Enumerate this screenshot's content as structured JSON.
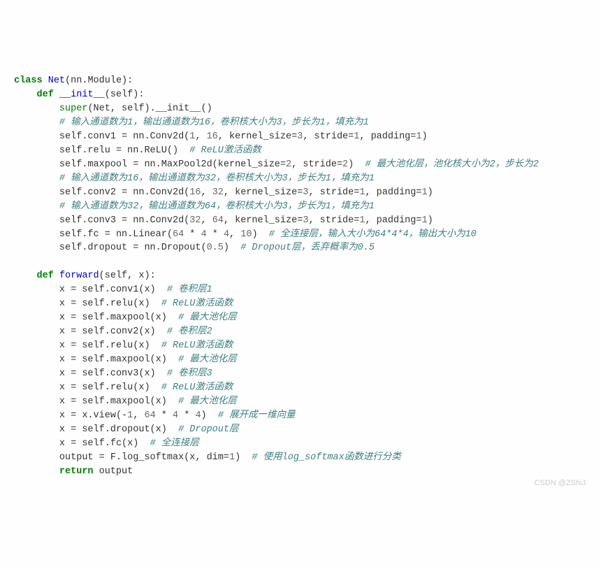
{
  "code": {
    "l1": {
      "kw1": "class",
      "cls": "Net",
      "paren": "(nn.Module):"
    },
    "l2": {
      "kw": "def",
      "fn": "__init__",
      "args": "(self):"
    },
    "l3": {
      "kw": "super",
      "txt": "(Net, self).__init__()"
    },
    "l4": {
      "cmt": "# 输入通道数为1，输出通道数为16，卷积核大小为3，步长为1，填充为1"
    },
    "l5": {
      "p1": "self.conv1 ",
      "op": "=",
      "p2": " nn.Conv2d(",
      "n1": "1",
      "c1": ", ",
      "n2": "16",
      "c2": ", kernel_size",
      "op2": "=",
      "n3": "3",
      "c3": ", stride",
      "op3": "=",
      "n4": "1",
      "c4": ", padding",
      "op4": "=",
      "n5": "1",
      "c5": ")"
    },
    "l6": {
      "p1": "self.relu ",
      "op": "=",
      "p2": " nn.ReLU()  ",
      "cmt": "# ReLU激活函数"
    },
    "l7": {
      "p1": "self.maxpool ",
      "op": "=",
      "p2": " nn.MaxPool2d(kernel_size",
      "op2": "=",
      "n1": "2",
      "c1": ", stride",
      "op3": "=",
      "n2": "2",
      "c2": ")  ",
      "cmt": "# 最大池化层，池化核大小为2，步长为2"
    },
    "l8": {
      "cmt": "# 输入通道数为16，输出通道数为32，卷积核大小为3，步长为1，填充为1"
    },
    "l9": {
      "p1": "self.conv2 ",
      "op": "=",
      "p2": " nn.Conv2d(",
      "n1": "16",
      "c1": ", ",
      "n2": "32",
      "c2": ", kernel_size",
      "op2": "=",
      "n3": "3",
      "c3": ", stride",
      "op3": "=",
      "n4": "1",
      "c4": ", padding",
      "op4": "=",
      "n5": "1",
      "c5": ")"
    },
    "l10": {
      "cmt": "# 输入通道数为32，输出通道数为64，卷积核大小为3，步长为1，填充为1"
    },
    "l11": {
      "p1": "self.conv3 ",
      "op": "=",
      "p2": " nn.Conv2d(",
      "n1": "32",
      "c1": ", ",
      "n2": "64",
      "c2": ", kernel_size",
      "op2": "=",
      "n3": "3",
      "c3": ", stride",
      "op3": "=",
      "n4": "1",
      "c4": ", padding",
      "op4": "=",
      "n5": "1",
      "c5": ")"
    },
    "l12": {
      "p1": "self.fc ",
      "op": "=",
      "p2": " nn.Linear(",
      "n1": "64",
      "c1": " ",
      "op2": "*",
      "c2": " ",
      "n2": "4",
      "c3": " ",
      "op3": "*",
      "c4": " ",
      "n3": "4",
      "c5": ", ",
      "n4": "10",
      "c6": ")  ",
      "cmt": "# 全连接层，输入大小为64*4*4，输出大小为10"
    },
    "l13": {
      "p1": "self.dropout ",
      "op": "=",
      "p2": " nn.Dropout(",
      "n1": "0.5",
      "c1": ")  ",
      "cmt": "# Dropout层，丢弃概率为0.5"
    },
    "l14": {
      "kw": "def",
      "fn": "forward",
      "args": "(self, x):"
    },
    "l15": {
      "p1": "x ",
      "op": "=",
      "p2": " self.conv1(x)  ",
      "cmt": "# 卷积层1"
    },
    "l16": {
      "p1": "x ",
      "op": "=",
      "p2": " self.relu(x)  ",
      "cmt": "# ReLU激活函数"
    },
    "l17": {
      "p1": "x ",
      "op": "=",
      "p2": " self.maxpool(x)  ",
      "cmt": "# 最大池化层"
    },
    "l18": {
      "p1": "x ",
      "op": "=",
      "p2": " self.conv2(x)  ",
      "cmt": "# 卷积层2"
    },
    "l19": {
      "p1": "x ",
      "op": "=",
      "p2": " self.relu(x)  ",
      "cmt": "# ReLU激活函数"
    },
    "l20": {
      "p1": "x ",
      "op": "=",
      "p2": " self.maxpool(x)  ",
      "cmt": "# 最大池化层"
    },
    "l21": {
      "p1": "x ",
      "op": "=",
      "p2": " self.conv3(x)  ",
      "cmt": "# 卷积层3"
    },
    "l22": {
      "p1": "x ",
      "op": "=",
      "p2": " self.relu(x)  ",
      "cmt": "# ReLU激活函数"
    },
    "l23": {
      "p1": "x ",
      "op": "=",
      "p2": " self.maxpool(x)  ",
      "cmt": "# 最大池化层"
    },
    "l24": {
      "p1": "x ",
      "op": "=",
      "p2": " x.view(",
      "op2": "-",
      "n1": "1",
      "c1": ", ",
      "n2": "64",
      "c2": " ",
      "op3": "*",
      "c3": " ",
      "n3": "4",
      "c4": " ",
      "op4": "*",
      "c5": " ",
      "n4": "4",
      "c6": ")  ",
      "cmt": "# 展开成一维向量"
    },
    "l25": {
      "p1": "x ",
      "op": "=",
      "p2": " self.dropout(x)  ",
      "cmt": "# Dropout层"
    },
    "l26": {
      "p1": "x ",
      "op": "=",
      "p2": " self.fc(x)  ",
      "cmt": "# 全连接层"
    },
    "l27": {
      "p1": "output ",
      "op": "=",
      "p2": " F.log_softmax(x, dim",
      "op2": "=",
      "n1": "1",
      "c1": ")  ",
      "cmt": "# 使用log_softmax函数进行分类"
    },
    "l28": {
      "kw": "return",
      "p1": " output"
    }
  },
  "watermark": "CSDN @ZShiJ"
}
